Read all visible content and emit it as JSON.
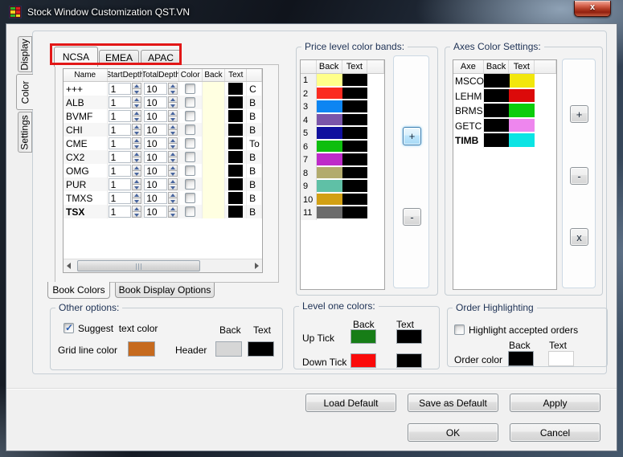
{
  "window": {
    "title": "Stock Window Customization QST.VN"
  },
  "side_tabs": {
    "items": [
      {
        "label": "Display",
        "selected": false
      },
      {
        "label": "Color",
        "selected": true
      },
      {
        "label": "Settings",
        "selected": false
      }
    ]
  },
  "region_tabs": {
    "items": [
      {
        "label": "NCSA",
        "selected": true
      },
      {
        "label": "EMEA",
        "selected": false
      },
      {
        "label": "APAC",
        "selected": false
      }
    ]
  },
  "book_table": {
    "columns": [
      "Name",
      "StartDepth",
      "TotalDepth",
      "Color",
      "Back",
      "Text"
    ],
    "rows": [
      {
        "name": "+++",
        "start_depth": "1",
        "total_depth": "10",
        "color_checked": false,
        "back": "#FFFFE1",
        "text": "#000000",
        "next_col": "C",
        "bold": false
      },
      {
        "name": "ALB",
        "start_depth": "1",
        "total_depth": "10",
        "color_checked": false,
        "back": "#FFFFE1",
        "text": "#000000",
        "next_col": "B",
        "bold": false
      },
      {
        "name": "BVMF",
        "start_depth": "1",
        "total_depth": "10",
        "color_checked": false,
        "back": "#FFFFE1",
        "text": "#000000",
        "next_col": "B",
        "bold": false
      },
      {
        "name": "CHI",
        "start_depth": "1",
        "total_depth": "10",
        "color_checked": false,
        "back": "#FFFFE1",
        "text": "#000000",
        "next_col": "B",
        "bold": false
      },
      {
        "name": "CME",
        "start_depth": "1",
        "total_depth": "10",
        "color_checked": false,
        "back": "#FFFFE1",
        "text": "#000000",
        "next_col": "To",
        "bold": false
      },
      {
        "name": "CX2",
        "start_depth": "1",
        "total_depth": "10",
        "color_checked": false,
        "back": "#FFFFE1",
        "text": "#000000",
        "next_col": "B",
        "bold": false
      },
      {
        "name": "OMG",
        "start_depth": "1",
        "total_depth": "10",
        "color_checked": false,
        "back": "#FFFFE1",
        "text": "#000000",
        "next_col": "B",
        "bold": false
      },
      {
        "name": "PUR",
        "start_depth": "1",
        "total_depth": "10",
        "color_checked": false,
        "back": "#FFFFE1",
        "text": "#000000",
        "next_col": "B",
        "bold": false
      },
      {
        "name": "TMXS",
        "start_depth": "1",
        "total_depth": "10",
        "color_checked": false,
        "back": "#FFFFE1",
        "text": "#000000",
        "next_col": "B",
        "bold": false
      },
      {
        "name": "TSX",
        "start_depth": "1",
        "total_depth": "10",
        "color_checked": false,
        "back": "#FFFFE1",
        "text": "#000000",
        "next_col": "B",
        "bold": true
      }
    ]
  },
  "book_tabs": {
    "items": [
      {
        "label": "Book Colors",
        "selected": true
      },
      {
        "label": "Book Display Options",
        "selected": false
      }
    ]
  },
  "price_bands": {
    "title": "Price level color bands:",
    "columns": [
      "Back",
      "Text"
    ],
    "rows": [
      {
        "num": "1",
        "back": "#FFFF8A",
        "text": "#000000"
      },
      {
        "num": "2",
        "back": "#FB2B20",
        "text": "#000000"
      },
      {
        "num": "3",
        "back": "#0D85F2",
        "text": "#000000"
      },
      {
        "num": "4",
        "back": "#7A55A9",
        "text": "#000000"
      },
      {
        "num": "5",
        "back": "#10109E",
        "text": "#000000"
      },
      {
        "num": "6",
        "back": "#0DBE0D",
        "text": "#000000"
      },
      {
        "num": "7",
        "back": "#BE2BC9",
        "text": "#000000"
      },
      {
        "num": "8",
        "back": "#B2AB6D",
        "text": "#000000"
      },
      {
        "num": "9",
        "back": "#5FC0A6",
        "text": "#000000"
      },
      {
        "num": "10",
        "back": "#D2A014",
        "text": "#000000"
      },
      {
        "num": "11",
        "back": "#6C6C6C",
        "text": "#000000"
      }
    ],
    "add_label": "+",
    "remove_label": "-"
  },
  "axes_settings": {
    "title": "Axes Color Settings:",
    "columns": [
      "Axe",
      "Back",
      "Text"
    ],
    "rows": [
      {
        "axe": "MSCO",
        "back": "#000000",
        "text": "#F2E70C",
        "bold": false
      },
      {
        "axe": "LEHM",
        "back": "#000000",
        "text": "#DC0A0A",
        "bold": false
      },
      {
        "axe": "BRMS",
        "back": "#000000",
        "text": "#0CCD0C",
        "bold": false
      },
      {
        "axe": "GETC",
        "back": "#000000",
        "text": "#EE86EE",
        "bold": false
      },
      {
        "axe": "TIMB",
        "back": "#000000",
        "text": "#0CE4E4",
        "bold": true
      }
    ],
    "add_label": "+",
    "remove_label": "-",
    "delete_label": "x"
  },
  "other_options": {
    "title": "Other options:",
    "suggest_label": "Suggest  text color",
    "suggest_checked": true,
    "grid_line_label": "Grid line color",
    "grid_line_color": "#C66A1E",
    "back_header": "Back",
    "text_header": "Text",
    "header_label": "Header",
    "header_back": "#D6D6D6",
    "header_text": "#000000"
  },
  "level_one": {
    "title": "Level one colors:",
    "back_header": "Back",
    "text_header": "Text",
    "rows": [
      {
        "label": "Up Tick",
        "back": "#177D17",
        "text": "#000000"
      },
      {
        "label": "Down Tick",
        "back": "#FB0A0A",
        "text": "#000000"
      }
    ]
  },
  "order_highlighting": {
    "title": "Order Highlighting",
    "checkbox_label": "Highlight accepted orders",
    "checked": false,
    "back_header": "Back",
    "text_header": "Text",
    "order_color_label": "Order color",
    "back": "#000000",
    "text": "#FFFFFF"
  },
  "footer": {
    "load_default": "Load Default",
    "save_as_default": "Save as Default",
    "apply": "Apply",
    "ok": "OK",
    "cancel": "Cancel"
  },
  "annotation_color": "#E21717"
}
